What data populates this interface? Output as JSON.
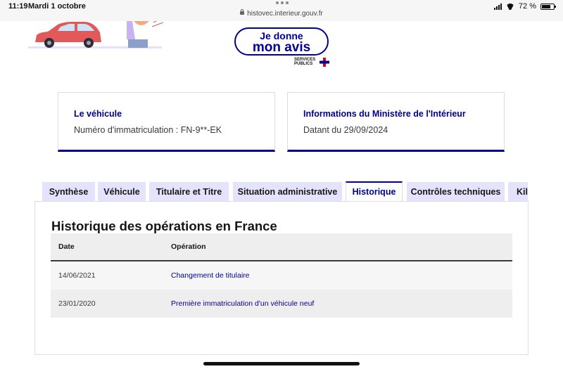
{
  "status_bar": {
    "time": "11:19",
    "date": "Mardi 1 octobre",
    "url": "histovec.interieur.gouv.fr",
    "battery": "72 %",
    "battery_level": 0.72
  },
  "banner": {
    "avis_line1": "Je donne",
    "avis_line2": "mon avis",
    "services_line1": "SERVICES",
    "services_line2": "PUBLICS"
  },
  "cards": {
    "vehicle": {
      "title": "Le véhicule",
      "text": "Numéro d'immatriculation : FN-9**-EK"
    },
    "ministry": {
      "title": "Informations du Ministère de l'Intérieur",
      "text": "Datant du 29/09/2024"
    }
  },
  "tabs": [
    {
      "label": "Synthèse",
      "active": false
    },
    {
      "label": "Véhicule",
      "active": false
    },
    {
      "label": "Titulaire et Titre",
      "active": false
    },
    {
      "label": "Situation administrative",
      "active": false
    },
    {
      "label": "Historique",
      "active": true
    },
    {
      "label": "Contrôles techniques",
      "active": false
    },
    {
      "label": "Kilométrage",
      "active": false
    }
  ],
  "history": {
    "title": "Historique des opérations en France",
    "columns": {
      "date": "Date",
      "operation": "Opération"
    },
    "rows": [
      {
        "date": "14/06/2021",
        "operation": "Changement de titulaire"
      },
      {
        "date": "23/01/2020",
        "operation": "Première immatriculation d'un véhicule neuf"
      }
    ]
  },
  "colors": {
    "brand_blue": "#000091",
    "tab_bg": "#e3e3fd",
    "marianne_red": "#e1000f"
  }
}
